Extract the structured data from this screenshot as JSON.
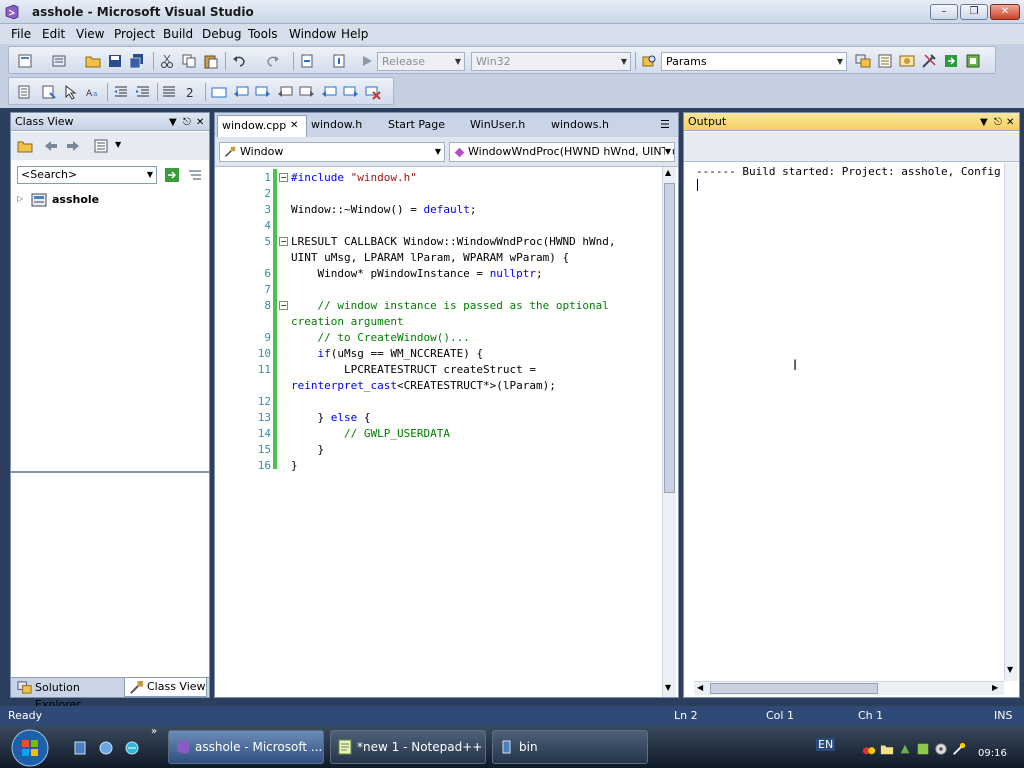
{
  "window": {
    "title": "asshole - Microsoft Visual Studio"
  },
  "menu": [
    "File",
    "Edit",
    "View",
    "Project",
    "Build",
    "Debug",
    "Tools",
    "Window",
    "Help"
  ],
  "toolbar": {
    "config": "Release",
    "platform": "Win32",
    "find_combo": "Params"
  },
  "classview": {
    "title": "Class View",
    "search_placeholder": "<Search>",
    "tree_root": "asshole",
    "tabs": {
      "solution": "Solution Explorer",
      "classview": "Class View"
    }
  },
  "editor": {
    "tabs": [
      "window.cpp",
      "window.h",
      "Start Page",
      "WinUser.h",
      "windows.h"
    ],
    "scope_combo": "Window",
    "member_combo": "WindowWndProc(HWND hWnd, UINT u",
    "lines": [
      {
        "no": "1",
        "parts": [
          {
            "t": "#include ",
            "c": "kw"
          },
          {
            "t": "\"window.h\"",
            "c": "str"
          }
        ]
      },
      {
        "no": "2",
        "parts": []
      },
      {
        "no": "3",
        "parts": [
          {
            "t": "Window::~Window() = ",
            "c": "txt"
          },
          {
            "t": "default",
            "c": "kw"
          },
          {
            "t": ";",
            "c": "txt"
          }
        ]
      },
      {
        "no": "4",
        "parts": []
      },
      {
        "no": "5",
        "parts": [
          {
            "t": "LRESULT CALLBACK Window::WindowWndProc(HWND hWnd,",
            "c": "txt"
          }
        ]
      },
      {
        "no": "",
        "parts": [
          {
            "t": "UINT uMsg, LPARAM lParam, WPARAM wParam) {",
            "c": "txt"
          }
        ]
      },
      {
        "no": "6",
        "parts": [
          {
            "t": "    Window* pWindowInstance = ",
            "c": "txt"
          },
          {
            "t": "nullptr",
            "c": "kw"
          },
          {
            "t": ";",
            "c": "txt"
          }
        ]
      },
      {
        "no": "7",
        "parts": []
      },
      {
        "no": "8",
        "parts": [
          {
            "t": "    // window instance is passed as the optional",
            "c": "cmt"
          }
        ]
      },
      {
        "no": "",
        "parts": [
          {
            "t": "creation argument",
            "c": "cmt"
          }
        ]
      },
      {
        "no": "9",
        "parts": [
          {
            "t": "    // to CreateWindow()...",
            "c": "cmt"
          }
        ]
      },
      {
        "no": "10",
        "parts": [
          {
            "t": "    ",
            "c": "txt"
          },
          {
            "t": "if",
            "c": "kw"
          },
          {
            "t": "(uMsg == WM_NCCREATE) {",
            "c": "txt"
          }
        ]
      },
      {
        "no": "11",
        "parts": [
          {
            "t": "        LPCREATESTRUCT createStruct =",
            "c": "txt"
          }
        ]
      },
      {
        "no": "",
        "parts": [
          {
            "t": "reinterpret_cast",
            "c": "kw"
          },
          {
            "t": "<CREATESTRUCT*>(lParam);",
            "c": "txt"
          }
        ]
      },
      {
        "no": "12",
        "parts": []
      },
      {
        "no": "13",
        "parts": [
          {
            "t": "    } ",
            "c": "txt"
          },
          {
            "t": "else",
            "c": "kw"
          },
          {
            "t": " {",
            "c": "txt"
          }
        ]
      },
      {
        "no": "14",
        "parts": [
          {
            "t": "        // GWLP_USERDATA",
            "c": "cmt"
          }
        ]
      },
      {
        "no": "15",
        "parts": [
          {
            "t": "    }",
            "c": "txt"
          }
        ]
      },
      {
        "no": "16",
        "parts": [
          {
            "t": "}",
            "c": "txt"
          }
        ]
      }
    ]
  },
  "output": {
    "title": "Output",
    "text": "------ Build started: Project: asshole, Configu"
  },
  "status": {
    "ready": "Ready",
    "ln": "Ln 2",
    "col": "Col 1",
    "ch": "Ch 1",
    "ins": "INS"
  },
  "taskbar": {
    "items": [
      "asshole - Microsoft ...",
      "*new  1 - Notepad++",
      "bin"
    ],
    "lang": "EN",
    "clock": "09:16"
  }
}
